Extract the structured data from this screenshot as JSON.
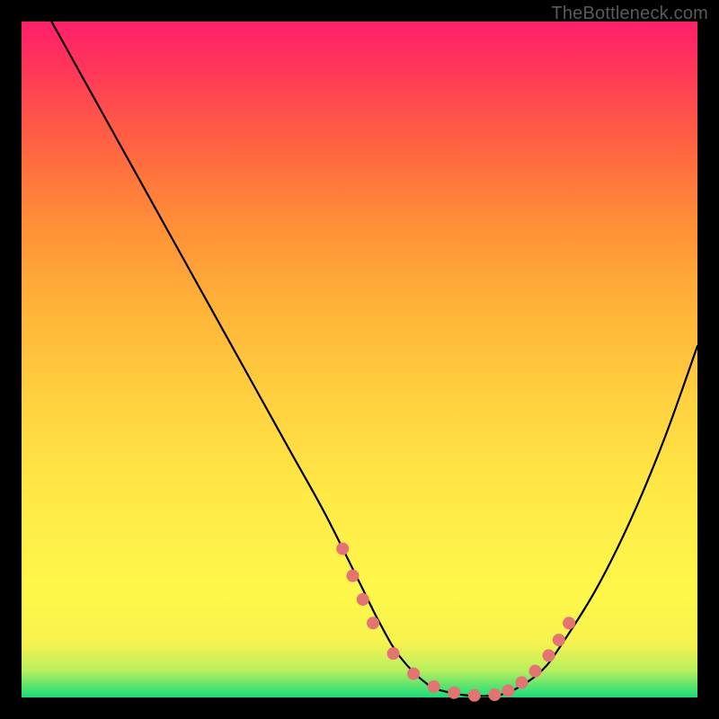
{
  "watermark": "TheBottleneck.com",
  "colors": {
    "curve_stroke": "#000000",
    "dot_fill": "#e57373",
    "background_black": "#000000"
  },
  "chart_data": {
    "type": "line",
    "title": "",
    "xlabel": "",
    "ylabel": "",
    "xlim": [
      0,
      100
    ],
    "ylim": [
      0,
      100
    ],
    "note": "Axes are implicit percentages of plot width/height; y is bottleneck % (0 at bottom).",
    "series": [
      {
        "name": "bottleneck-curve",
        "x": [
          0,
          5,
          10,
          15,
          20,
          25,
          30,
          35,
          40,
          45,
          50,
          53,
          56,
          60,
          63,
          66,
          70,
          73,
          77,
          80,
          85,
          90,
          95,
          100
        ],
        "y": [
          108,
          99,
          90,
          81,
          72,
          63,
          54,
          45,
          36,
          27,
          17,
          11,
          6,
          2,
          0.8,
          0.3,
          0.3,
          1.2,
          4,
          8,
          16,
          26,
          38,
          52
        ]
      }
    ],
    "dots": {
      "name": "highlight-points",
      "x": [
        47.5,
        49,
        50.5,
        52,
        55,
        58,
        61,
        64,
        67,
        70,
        72,
        74,
        76,
        78,
        79.5,
        81
      ],
      "y": [
        22,
        18,
        14.5,
        11,
        6.5,
        3.5,
        1.6,
        0.7,
        0.3,
        0.4,
        1.0,
        2.2,
        3.9,
        6.2,
        8.5,
        11
      ]
    }
  }
}
